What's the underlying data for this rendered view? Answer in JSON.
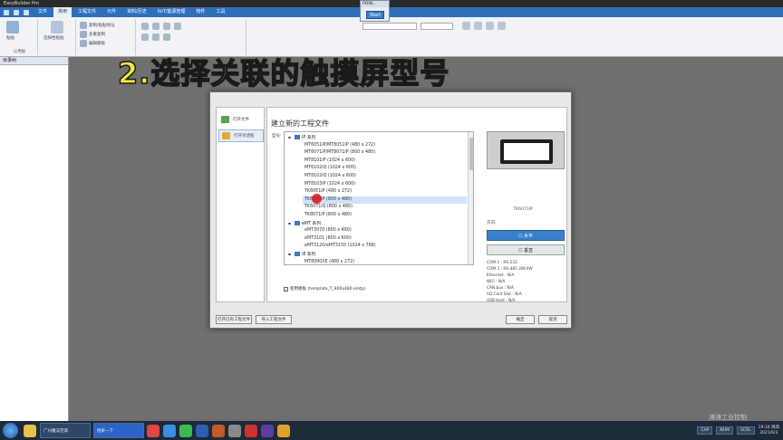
{
  "window": {
    "title": "EasyBuilder Pro"
  },
  "menu": {
    "items": [
      "文件",
      "常用",
      "工程文件",
      "元件",
      "资料/历史",
      "IIoT/能源管理",
      "物件",
      "工具"
    ],
    "active_index": 1
  },
  "ribbon": {
    "groups": [
      {
        "label": "粘贴"
      },
      {
        "label": "公用板"
      },
      {
        "label": "编辑"
      }
    ],
    "texts": {
      "paste": "粘贴",
      "clipboard": "公用板",
      "paste_special": "选择性粘贴",
      "copy_sub": "复制/粘贴地址",
      "multi_copy": "多重复制",
      "edit_template": "编辑模板"
    }
  },
  "float_window": {
    "title": "POIN..",
    "start_label": "Start"
  },
  "left_panel": {
    "title": "目录树"
  },
  "caption": "2.选择关联的触摸屏型号",
  "dialog": {
    "side_items": [
      {
        "label": "打开文件",
        "icon_color": "#5aa05a"
      },
      {
        "label": "打开对话框",
        "icon_color": "#e6a83a"
      }
    ],
    "heading": "建立新的工程文件",
    "model_label": "型号:",
    "tree": [
      {
        "type": "group",
        "label": "IP 系列",
        "expander": "▪"
      },
      {
        "type": "item",
        "label": "MT6051iP/MT8051iP (480 x 272)"
      },
      {
        "type": "item",
        "label": "MT6071iP/MT8071iP (800 x 480)"
      },
      {
        "type": "item",
        "label": "MT8101iP (1024 x 600)"
      },
      {
        "type": "item",
        "label": "MT6102iQ (1024 x 600)"
      },
      {
        "type": "item",
        "label": "MT8102iQ (1024 x 600)"
      },
      {
        "type": "item",
        "label": "MT8103iP (1024 x 600)"
      },
      {
        "type": "item",
        "label": "TK6051iP (480 x 272)"
      },
      {
        "type": "item",
        "label": "TK6071iP (800 x 480)",
        "selected": true
      },
      {
        "type": "item",
        "label": "TK6071iQ (800 x 480)"
      },
      {
        "type": "item",
        "label": "TK8071iP (800 x 480)"
      },
      {
        "type": "group",
        "label": "eMT 系列",
        "expander": "▪"
      },
      {
        "type": "item",
        "label": "eMT3070 (800 x 480)"
      },
      {
        "type": "item",
        "label": "eMT3101 (800 x 600)"
      },
      {
        "type": "item",
        "label": "eMT3120/eMT3150 (1024 x 768)"
      },
      {
        "type": "group",
        "label": "iE 系列",
        "expander": "▪"
      },
      {
        "type": "item",
        "label": "MT8090XE (480 x 272)"
      }
    ],
    "template_check": "使用模板 (template_T_800x480.emtp)",
    "preview_model": "TK6071iP",
    "orientation_label": "方向:",
    "orientation_h": "☐ 水平",
    "orientation_v": "☐ 垂直",
    "specs": [
      "COM 1 : RS-232",
      "COM 2 : RS-485 2W/4W",
      "Ethernet : N/A",
      "WiFi : N/A",
      "CAN bus : N/A",
      "SD Card Slot : N/A",
      "USB Host : N/A"
    ],
    "btn_open": "打开已有工程文件",
    "btn_import": "导入工程文件",
    "btn_ok": "确定",
    "btn_cancel": "取消"
  },
  "taskbar": {
    "tasks": [
      "广州魔法范城",
      "搜索一下"
    ],
    "tray_labels": [
      "CAP",
      "NUM",
      "SCRL"
    ],
    "clock_time": "19:34 周四",
    "clock_date": "2021/6/3"
  },
  "watermark": "涛涛工业控制"
}
